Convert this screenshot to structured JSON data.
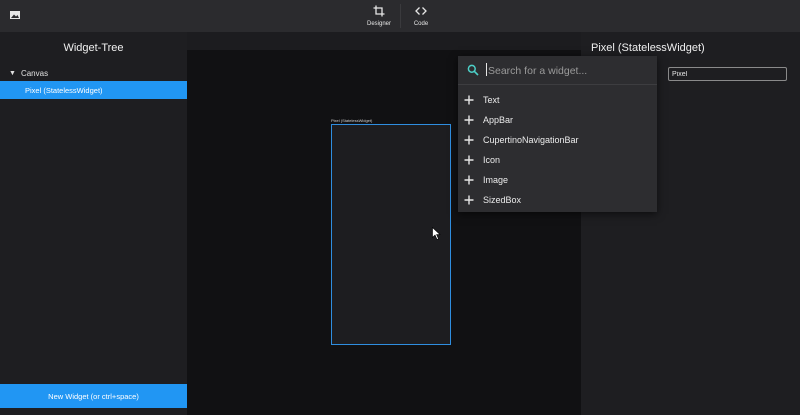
{
  "toolbar": {
    "app_icon": "image-icon",
    "modes": [
      {
        "label": "Designer",
        "icon": "crop-icon"
      },
      {
        "label": "Code",
        "icon": "code-icon"
      }
    ]
  },
  "widget_tree": {
    "title": "Widget-Tree",
    "root": "Canvas",
    "items": [
      {
        "label": "Pixel (StatelessWidget)"
      }
    ],
    "new_widget_label": "New Widget (or ctrl+space)"
  },
  "canvas": {
    "device_caption": "Pixel (StatelessWidget)"
  },
  "properties": {
    "title": "Pixel (StatelessWidget)",
    "name_value": "Pixel"
  },
  "widget_picker": {
    "search_placeholder": "Search for a widget...",
    "options": [
      "Text",
      "AppBar",
      "CupertinoNavigationBar",
      "Icon",
      "Image",
      "SizedBox"
    ]
  },
  "colors": {
    "accent": "#2196f3",
    "search_icon": "#4dd0c8"
  }
}
